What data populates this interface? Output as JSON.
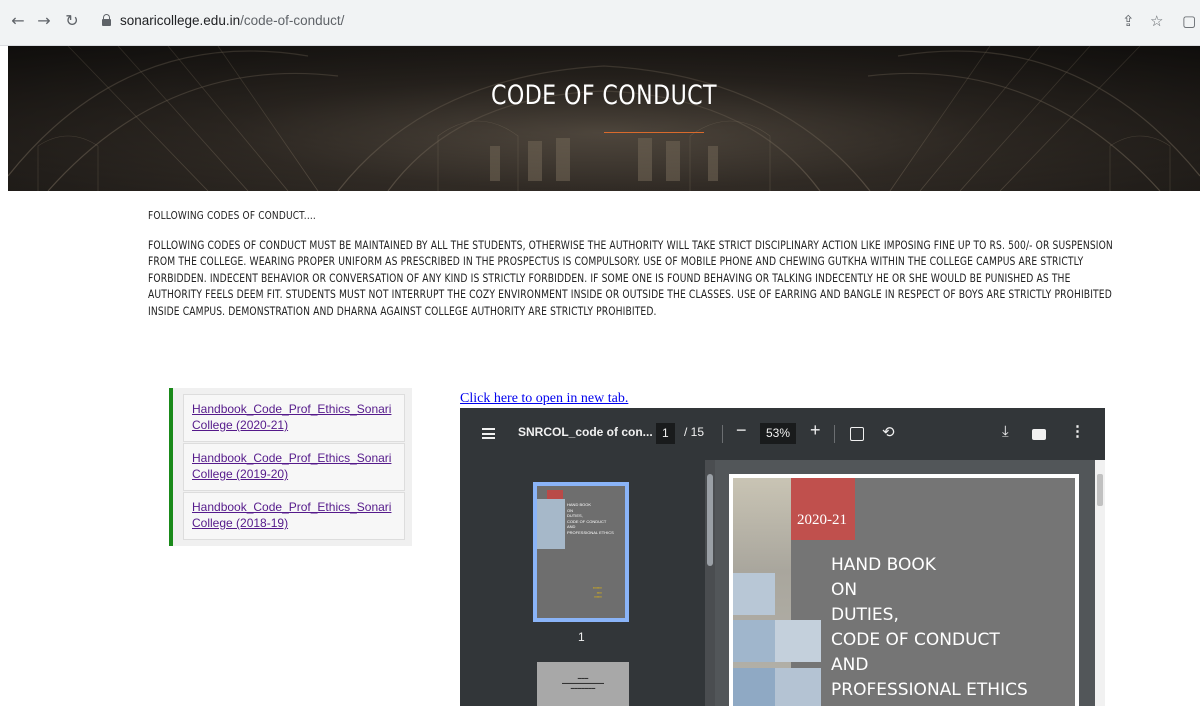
{
  "browser": {
    "url_domain": "sonaricollege.edu.in",
    "url_path": "/code-of-conduct/"
  },
  "hero": {
    "title": "CODE OF CONDUCT"
  },
  "intro": {
    "heading": "FOLLOWING CODES OF CONDUCT....",
    "body": "FOLLOWING CODES OF CONDUCT MUST BE MAINTAINED BY ALL THE STUDENTS, OTHERWISE THE AUTHORITY WILL TAKE STRICT DISCIPLINARY ACTION LIKE IMPOSING FINE UP TO RS. 500/- OR SUSPENSION FROM THE COLLEGE. WEARING PROPER UNIFORM AS PRESCRIBED IN THE PROSPECTUS IS COMPULSORY. USE OF MOBILE PHONE AND CHEWING GUTKHA WITHIN THE COLLEGE CAMPUS ARE STRICTLY FORBIDDEN. INDECENT BEHAVIOR OR CONVERSATION OF ANY KIND IS STRICTLY FORBIDDEN. IF SOME ONE IS FOUND BEHAVING OR TALKING INDECENTLY HE OR SHE WOULD BE PUNISHED AS THE AUTHORITY FEELS DEEM FIT. STUDENTS MUST NOT INTERRUPT THE COZY ENVIRONMENT INSIDE OR OUTSIDE THE CLASSES. USE OF EARRING AND BANGLE IN RESPECT OF BOYS ARE STRICTLY PROHIBITED INSIDE CAMPUS. DEMONSTRATION AND DHARNA AGAINST COLLEGE AUTHORITY ARE STRICTLY PROHIBITED."
  },
  "sidebar": {
    "items": [
      {
        "label": "Handbook_Code_Prof_Ethics_Sonari College (2020-21)"
      },
      {
        "label": "Handbook_Code_Prof_Ethics_Sonari College (2019-20)"
      },
      {
        "label": "Handbook_Code_Prof_Ethics_Sonari College (2018-19)"
      }
    ]
  },
  "open_new_tab": "Click here to open in new tab.",
  "pdf": {
    "filename": "SNRCOL_code of con...",
    "current_page": "1",
    "total_pages": "/ 15",
    "zoom": "53%",
    "thumb_label": "1",
    "cover": {
      "year": "2020-21",
      "title_lines": "HAND BOOK\nON\nDUTIES,\nCODE OF CONDUCT\nAND\nPROFESSIONAL ETHICS"
    }
  },
  "colors": {
    "accent_green": "#1a8a1a",
    "hero_rule": "#d96a2c",
    "cover_red": "#c0504d"
  }
}
